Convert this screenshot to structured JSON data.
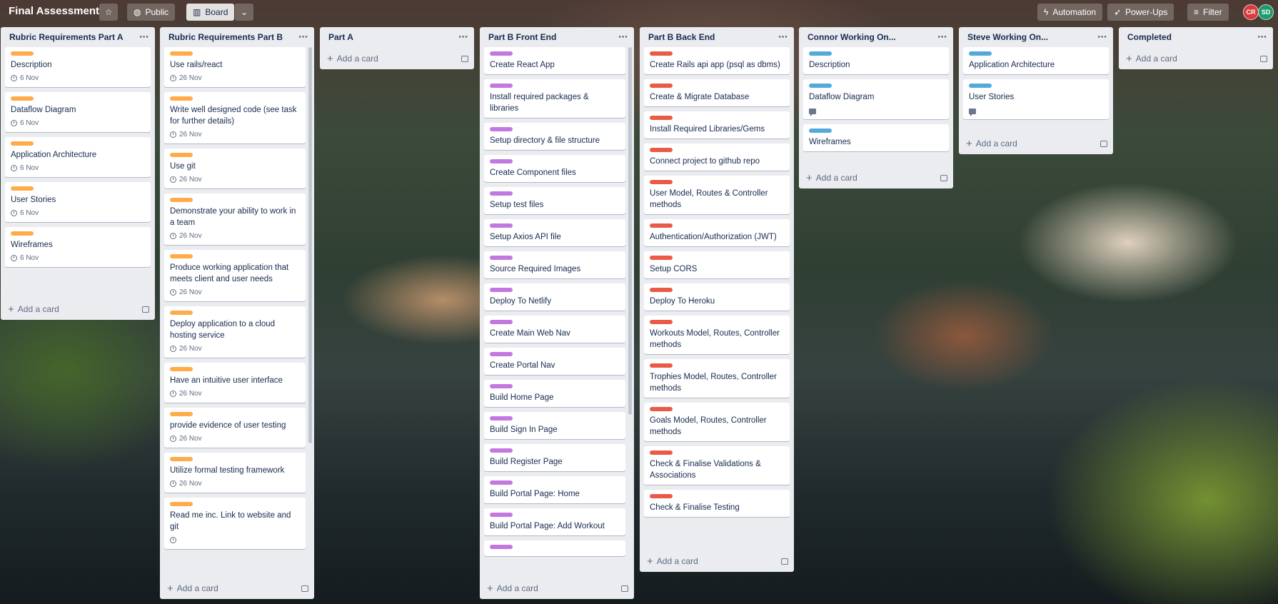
{
  "board": {
    "title": "Final Assessment",
    "visibility": "Public",
    "view": "Board",
    "automation": "Automation",
    "powerups": "Power-Ups",
    "filter": "Filter",
    "members": [
      {
        "initials": "CR",
        "color": "#d93a3a"
      },
      {
        "initials": "SD",
        "color": "#1e9a6c"
      }
    ]
  },
  "labels": {
    "orange": "#ffab4a",
    "purple": "#c377e0",
    "red": "#eb5a46",
    "blue": "#55a9da"
  },
  "add_card": "Add a card",
  "lists": [
    {
      "title": "Rubric Requirements Part A",
      "cards": [
        {
          "label": "orange",
          "title": "Description",
          "due": "6 Nov"
        },
        {
          "label": "orange",
          "title": "Dataflow Diagram",
          "due": "6 Nov"
        },
        {
          "label": "orange",
          "title": "Application Architecture",
          "due": "6 Nov"
        },
        {
          "label": "orange",
          "title": "User Stories",
          "due": "6 Nov"
        },
        {
          "label": "orange",
          "title": "Wireframes",
          "due": "6 Nov"
        }
      ]
    },
    {
      "title": "Rubric Requirements Part B",
      "cards": [
        {
          "label": "orange",
          "title": "Use rails/react",
          "due": "26 Nov"
        },
        {
          "label": "orange",
          "title": "Write well designed code (see task for further details)",
          "due": "26 Nov"
        },
        {
          "label": "orange",
          "title": "Use git",
          "due": "26 Nov"
        },
        {
          "label": "orange",
          "title": "Demonstrate your ability to work in a team",
          "due": "26 Nov"
        },
        {
          "label": "orange",
          "title": "Produce working application that meets client and user needs",
          "due": "26 Nov"
        },
        {
          "label": "orange",
          "title": "Deploy application to a cloud hosting service",
          "due": "26 Nov"
        },
        {
          "label": "orange",
          "title": "Have an intuitive user interface",
          "due": "26 Nov"
        },
        {
          "label": "orange",
          "title": "provide evidence of user testing",
          "due": "26 Nov"
        },
        {
          "label": "orange",
          "title": "Utilize formal testing framework",
          "due": "26 Nov"
        },
        {
          "label": "orange",
          "title": "Read me inc. Link to website and git",
          "due": ""
        }
      ]
    },
    {
      "title": "Part A",
      "cards": []
    },
    {
      "title": "Part B Front End",
      "cards": [
        {
          "label": "purple",
          "title": "Create React App"
        },
        {
          "label": "purple",
          "title": "Install required packages & libraries"
        },
        {
          "label": "purple",
          "title": "Setup directory & file structure"
        },
        {
          "label": "purple",
          "title": "Create Component files"
        },
        {
          "label": "purple",
          "title": "Setup test files"
        },
        {
          "label": "purple",
          "title": "Setup Axios API file"
        },
        {
          "label": "purple",
          "title": "Source Required Images"
        },
        {
          "label": "purple",
          "title": "Deploy To Netlify"
        },
        {
          "label": "purple",
          "title": "Create Main Web Nav"
        },
        {
          "label": "purple",
          "title": "Create Portal Nav"
        },
        {
          "label": "purple",
          "title": "Build Home Page"
        },
        {
          "label": "purple",
          "title": "Build Sign In Page"
        },
        {
          "label": "purple",
          "title": "Build Register Page"
        },
        {
          "label": "purple",
          "title": "Build Portal Page: Home"
        },
        {
          "label": "purple",
          "title": "Build Portal Page: Add Workout"
        },
        {
          "label": "purple",
          "title": ""
        }
      ]
    },
    {
      "title": "Part B Back End",
      "cards": [
        {
          "label": "red",
          "title": "Create Rails api app (psql as dbms)"
        },
        {
          "label": "red",
          "title": "Create & Migrate Database"
        },
        {
          "label": "red",
          "title": "Install Required Libraries/Gems"
        },
        {
          "label": "red",
          "title": "Connect project to github repo"
        },
        {
          "label": "red",
          "title": "User Model, Routes & Controller methods"
        },
        {
          "label": "red",
          "title": "Authentication/Authorization (JWT)"
        },
        {
          "label": "red",
          "title": "Setup CORS"
        },
        {
          "label": "red",
          "title": "Deploy To Heroku"
        },
        {
          "label": "red",
          "title": "Workouts Model, Routes, Controller methods"
        },
        {
          "label": "red",
          "title": "Trophies Model, Routes, Controller methods"
        },
        {
          "label": "red",
          "title": "Goals Model, Routes, Controller methods"
        },
        {
          "label": "red",
          "title": "Check & Finalise Validations & Associations"
        },
        {
          "label": "red",
          "title": "Check & Finalise Testing"
        }
      ]
    },
    {
      "title": "Connor Working On...",
      "cards": [
        {
          "label": "blue",
          "title": "Description"
        },
        {
          "label": "blue",
          "title": "Dataflow Diagram",
          "comment": true
        },
        {
          "label": "blue",
          "title": "Wireframes"
        }
      ]
    },
    {
      "title": "Steve Working On...",
      "cards": [
        {
          "label": "blue",
          "title": "Application Architecture"
        },
        {
          "label": "blue",
          "title": "User Stories",
          "comment": true
        }
      ]
    },
    {
      "title": "Completed",
      "cards": []
    }
  ]
}
